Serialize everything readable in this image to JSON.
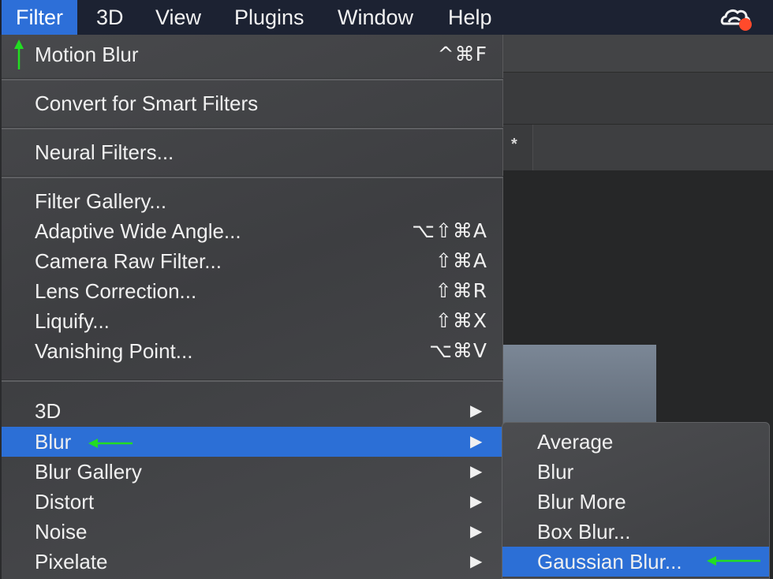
{
  "menubar": {
    "items": [
      {
        "label": "Filter",
        "active": true
      },
      {
        "label": "3D",
        "active": false
      },
      {
        "label": "View",
        "active": false
      },
      {
        "label": "Plugins",
        "active": false
      },
      {
        "label": "Window",
        "active": false
      },
      {
        "label": "Help",
        "active": false
      }
    ],
    "status_icon": "creative-cloud-icon"
  },
  "document": {
    "tab_label": "*"
  },
  "filter_menu": {
    "sections": [
      [
        {
          "label": "Motion Blur",
          "shortcut": "^⌘F"
        }
      ],
      [
        {
          "label": "Convert for Smart Filters",
          "shortcut": ""
        }
      ],
      [
        {
          "label": "Neural Filters...",
          "shortcut": ""
        }
      ],
      [
        {
          "label": "Filter Gallery...",
          "shortcut": ""
        },
        {
          "label": "Adaptive Wide Angle...",
          "shortcut": "⌥⇧⌘A"
        },
        {
          "label": "Camera Raw Filter...",
          "shortcut": "⇧⌘A"
        },
        {
          "label": "Lens Correction...",
          "shortcut": "⇧⌘R"
        },
        {
          "label": "Liquify...",
          "shortcut": "⇧⌘X"
        },
        {
          "label": "Vanishing Point...",
          "shortcut": "⌥⌘V"
        }
      ],
      [
        {
          "label": "3D",
          "submenu": true
        },
        {
          "label": "Blur",
          "submenu": true,
          "highlighted": true
        },
        {
          "label": "Blur Gallery",
          "submenu": true
        },
        {
          "label": "Distort",
          "submenu": true
        },
        {
          "label": "Noise",
          "submenu": true
        },
        {
          "label": "Pixelate",
          "submenu": true
        }
      ]
    ],
    "submenu_arrow": "▶"
  },
  "blur_submenu": {
    "items": [
      {
        "label": "Average"
      },
      {
        "label": "Blur"
      },
      {
        "label": "Blur More"
      },
      {
        "label": "Box Blur..."
      },
      {
        "label": "Gaussian Blur...",
        "highlighted": true
      }
    ]
  },
  "colors": {
    "menubar_bg": "#1c2232",
    "highlight": "#2c6fd6",
    "annotation_arrow": "#22dd22",
    "cc_badge": "#ff4a2b"
  }
}
